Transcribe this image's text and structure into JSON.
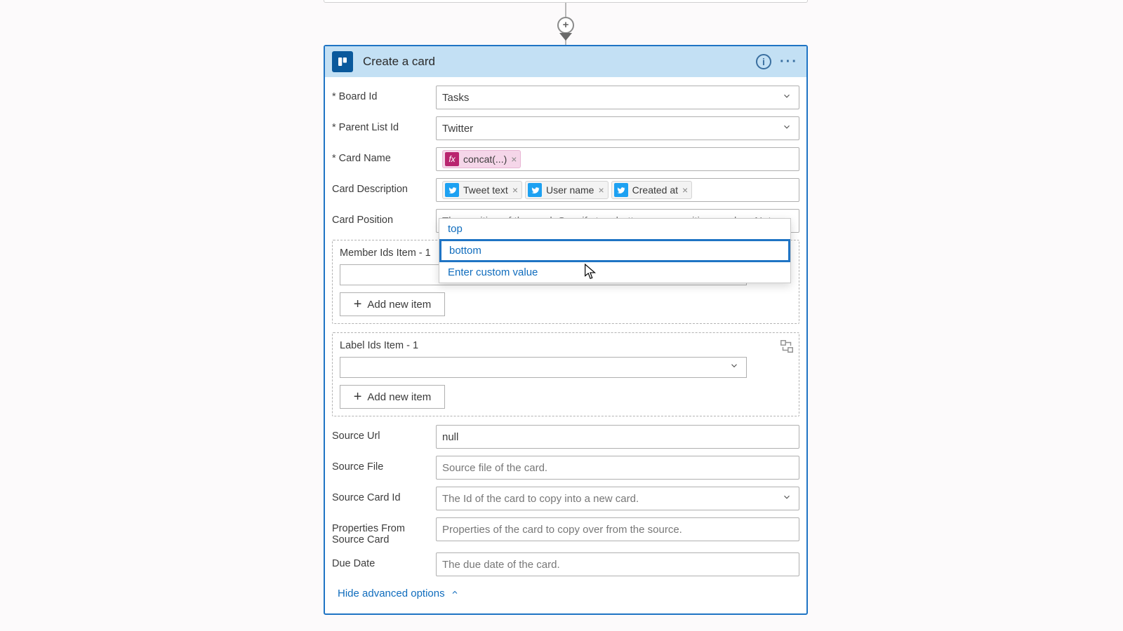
{
  "header": {
    "title": "Create a card"
  },
  "fields": {
    "boardId": {
      "label": "Board Id",
      "value": "Tasks"
    },
    "parentListId": {
      "label": "Parent List Id",
      "value": "Twitter"
    },
    "cardName": {
      "label": "Card Name",
      "fxToken": "concat(...)"
    },
    "cardDesc": {
      "label": "Card Description",
      "tokens": [
        "Tweet text",
        "User name",
        "Created at"
      ]
    },
    "cardPosition": {
      "label": "Card Position",
      "placeholder": "The position of the card. Specify top, bottom, or a positive number. Note"
    },
    "memberIds": {
      "label": "Member Ids Item - 1",
      "addLabel": "Add new item"
    },
    "labelIds": {
      "label": "Label Ids Item - 1",
      "addLabel": "Add new item"
    },
    "sourceUrl": {
      "label": "Source Url",
      "value": "null"
    },
    "sourceFile": {
      "label": "Source File",
      "placeholder": "Source file of the card."
    },
    "sourceCardId": {
      "label": "Source Card Id",
      "placeholder": "The Id of the card to copy into a new card."
    },
    "propsFromSrc": {
      "label": "Properties From Source Card",
      "placeholder": "Properties of the card to copy over from the source."
    },
    "dueDate": {
      "label": "Due Date",
      "placeholder": "The due date of the card."
    }
  },
  "dropdown": {
    "options": [
      "top",
      "bottom",
      "Enter custom value"
    ],
    "highlightedIndex": 1
  },
  "footer": {
    "hideAdvanced": "Hide advanced options"
  }
}
